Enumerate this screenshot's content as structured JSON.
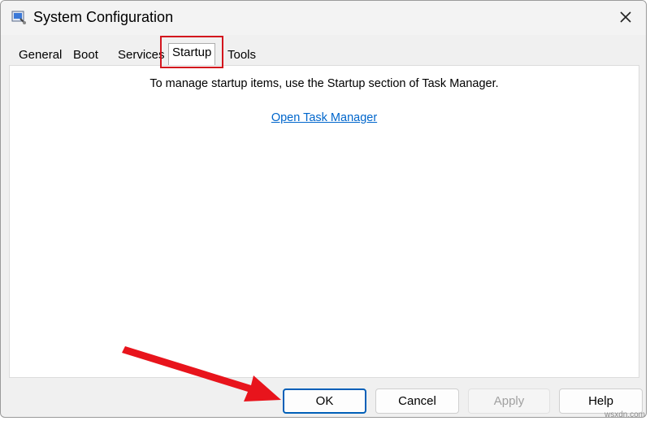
{
  "window": {
    "title": "System Configuration",
    "close_icon": "close-icon"
  },
  "tabs": [
    {
      "label": "General"
    },
    {
      "label": "Boot"
    },
    {
      "label": "Services"
    },
    {
      "label": "Startup",
      "active": true
    },
    {
      "label": "Tools"
    }
  ],
  "startup_panel": {
    "message": "To manage startup items, use the Startup section of Task Manager.",
    "link_label": "Open Task Manager"
  },
  "buttons": {
    "ok": "OK",
    "cancel": "Cancel",
    "apply": "Apply",
    "help": "Help"
  },
  "annotations": {
    "highlight_color": "#d3151d",
    "arrow_color": "#e8141c"
  },
  "watermark": "wsxdn.com",
  "colors": {
    "link": "#0066cc",
    "accent_border": "#005fb8"
  }
}
